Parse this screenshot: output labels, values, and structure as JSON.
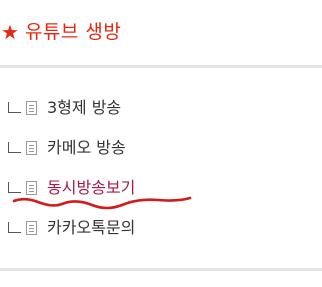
{
  "header": {
    "title": "유튜브 생방",
    "icon": "star-icon",
    "accent_color": "#e5280f"
  },
  "menu": {
    "items": [
      {
        "label": "3형제 방송",
        "color": "#333333",
        "icon": "document-icon"
      },
      {
        "label": "카메오 방송",
        "color": "#333333",
        "icon": "document-icon"
      },
      {
        "label": "동시방송보기",
        "color": "#a8184a",
        "icon": "document-icon"
      },
      {
        "label": "카카오톡문의",
        "color": "#333333",
        "icon": "document-icon"
      }
    ]
  },
  "annotation": {
    "mark": "red-squiggle-underline",
    "color": "#d41a1a"
  }
}
